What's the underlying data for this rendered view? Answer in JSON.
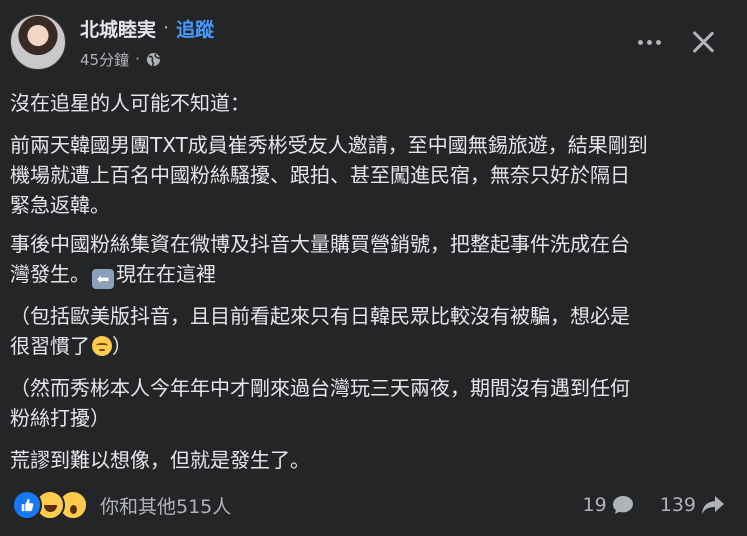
{
  "header": {
    "author": "北城睦実",
    "separator": "·",
    "follow": "追蹤",
    "time": "45分鐘",
    "time_separator": "·",
    "privacy_icon": "globe-icon"
  },
  "actions": {
    "more_icon": "more-dots-icon",
    "close_icon": "close-icon"
  },
  "post": {
    "p1": "沒在追星的人可能不知道：",
    "p2_line1": "前兩天韓國男團TXT成員崔秀彬受友人邀請，至中國無錫旅遊，結果剛到",
    "p2_line2": "機場就遭上百名中國粉絲騷擾、跟拍、甚至闖進民宿，無奈只好於隔日",
    "p2_line3": "緊急返韓。",
    "p3_line1": "事後中國粉絲集資在微博及抖音大量購買營銷號，把整起事件洗成在台",
    "p3_line2_a": "灣發生。",
    "p3_arrow_emoji": "⬅",
    "p3_line2_b": "現在在這裡",
    "p4_line1": "（包括歐美版抖音，且目前看起來只有日韓民眾比較沒有被騙，想必是",
    "p4_line2": "很習慣了",
    "p4_line2_end": "）",
    "p5_line1": "（然而秀彬本人今年年中才剛來過台灣玩三天兩夜，期間沒有遇到任何",
    "p5_line2": "粉絲打擾）",
    "p6": "荒謬到難以想像，但就是發生了。"
  },
  "footer": {
    "reactions": [
      "like-icon",
      "haha-icon",
      "wow-icon"
    ],
    "reaction_text": "你和其他515人",
    "comments": "19",
    "shares": "139"
  },
  "colors": {
    "background": "#242526",
    "text": "#e4e6eb",
    "secondary": "#b0b3b8",
    "link": "#4599ff",
    "like": "#1877f2"
  }
}
